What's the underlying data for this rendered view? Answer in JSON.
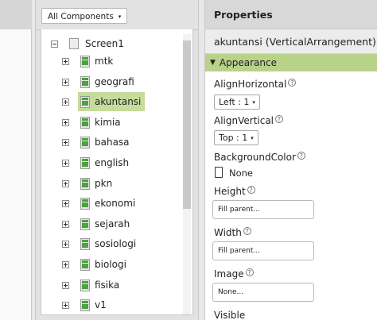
{
  "components": {
    "filter_label": "All Components",
    "tree": [
      {
        "label": "Screen1",
        "type": "screen",
        "expanded": true
      },
      {
        "label": "mtk",
        "type": "arrangement"
      },
      {
        "label": "geografi",
        "type": "arrangement"
      },
      {
        "label": "akuntansi",
        "type": "arrangement",
        "selected": true
      },
      {
        "label": "kimia",
        "type": "arrangement"
      },
      {
        "label": "bahasa",
        "type": "arrangement"
      },
      {
        "label": "english",
        "type": "arrangement"
      },
      {
        "label": "pkn",
        "type": "arrangement"
      },
      {
        "label": "ekonomi",
        "type": "arrangement"
      },
      {
        "label": "sejarah",
        "type": "arrangement"
      },
      {
        "label": "sosiologi",
        "type": "arrangement"
      },
      {
        "label": "biologi",
        "type": "arrangement"
      },
      {
        "label": "fisika",
        "type": "arrangement"
      },
      {
        "label": "v1",
        "type": "arrangement"
      }
    ]
  },
  "properties": {
    "title": "Properties",
    "component": "akuntansi (VerticalArrangement)",
    "section": "Appearance",
    "help_glyph": "?",
    "align_horizontal": {
      "label": "AlignHorizontal",
      "value": "Left : 1"
    },
    "align_vertical": {
      "label": "AlignVertical",
      "value": "Top : 1"
    },
    "background_color": {
      "label": "BackgroundColor",
      "value": "None"
    },
    "height": {
      "label": "Height",
      "value": "Fill parent..."
    },
    "width": {
      "label": "Width",
      "value": "Fill parent..."
    },
    "image": {
      "label": "Image",
      "value": "None..."
    },
    "visible": {
      "label": "Visible"
    }
  },
  "colors": {
    "selected_row": "#c7db9c",
    "section_header": "#b9d28a",
    "arrangement_icon": "#4aa33c"
  },
  "icons": {
    "caret": "▾",
    "collapse": "▼"
  }
}
